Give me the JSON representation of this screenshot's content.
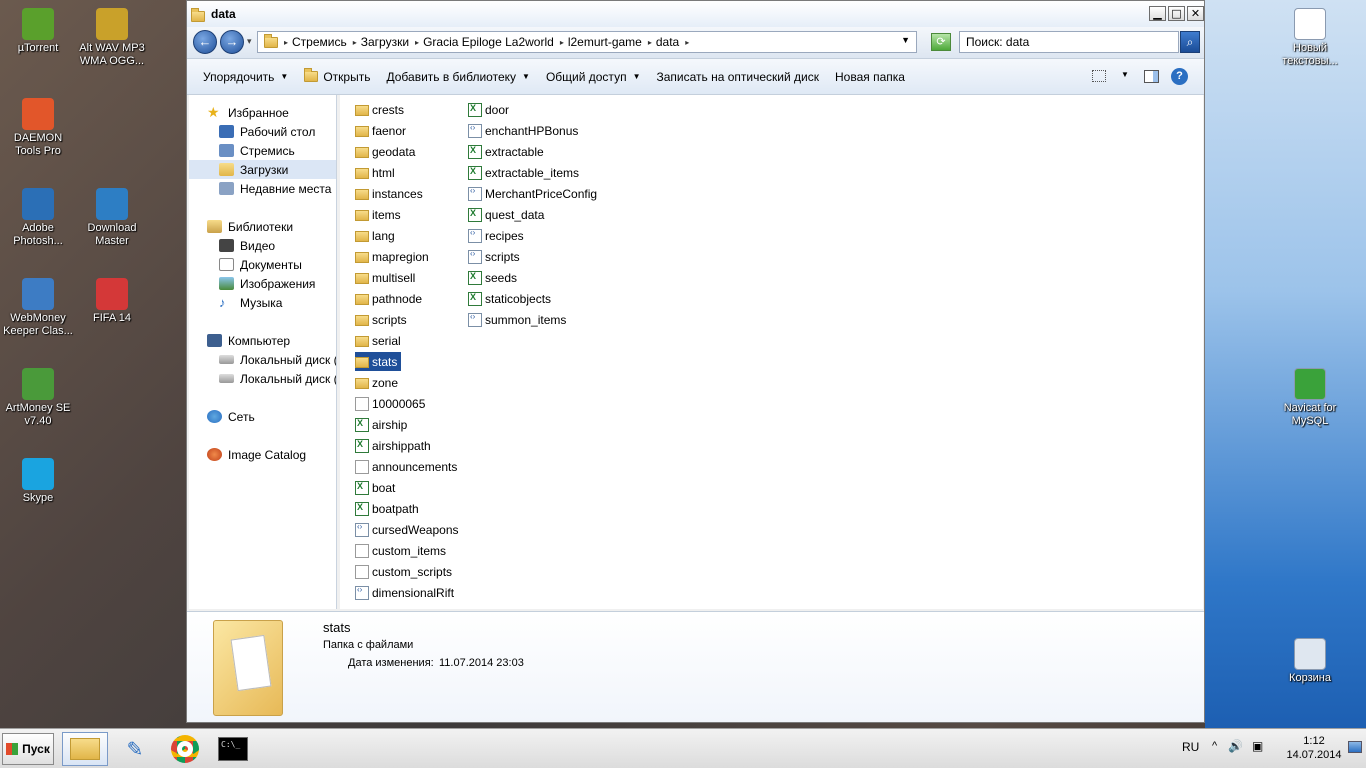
{
  "desktop": {
    "icons_left": [
      {
        "label": "µTorrent",
        "icon": "utorrent-icon",
        "color": "#5aa02c"
      },
      {
        "label": "Alt WAV MP3 WMA OGG...",
        "icon": "disc-icon",
        "color": "#c9a12a"
      },
      {
        "label": "DAEMON Tools Pro",
        "icon": "daemon-tools-icon",
        "color": "#e2562a"
      },
      {
        "label": "Adobe Photosh...",
        "icon": "photoshop-icon",
        "color": "#2b6fb6"
      },
      {
        "label": "Download Master",
        "icon": "download-master-icon",
        "color": "#2d7ec4"
      },
      {
        "label": "WebMoney Keeper Clas...",
        "icon": "webmoney-icon",
        "color": "#3d7cc4"
      },
      {
        "label": "FIFA 14",
        "icon": "fifa-icon",
        "color": "#d43838"
      },
      {
        "label": "ArtMoney SE v7.40",
        "icon": "artmoney-icon",
        "color": "#4a9a3a"
      },
      {
        "label": "Skype",
        "icon": "skype-icon",
        "color": "#1aa4e0"
      }
    ],
    "icons_right": [
      {
        "label": "Новый текстовы...",
        "icon": "text-document-icon",
        "color": "#ffffff"
      },
      {
        "label": "Navicat for MySQL",
        "icon": "navicat-icon",
        "color": "#3aa23a"
      },
      {
        "label": "Корзина",
        "icon": "recycle-bin-icon",
        "color": "#dfe7f0"
      }
    ]
  },
  "window": {
    "title": "data",
    "controls": {
      "minimize": "▁",
      "maximize": "□",
      "close": "✕"
    },
    "nav": {
      "back": "←",
      "forward": "→",
      "recent": "▾"
    },
    "breadcrumb": [
      "Стремись",
      "Загрузки",
      "Gracia Epiloge La2world",
      "l2emurt-game",
      "data"
    ],
    "breadcrumb_separator": "▸",
    "search_placeholder": "Поиск: data",
    "search_icon_glyph": "⌕",
    "refresh_glyph": "⟳",
    "toolbar": {
      "organize": "Упорядочить",
      "open": "Открыть",
      "add_to_library": "Добавить в библиотеку",
      "share": "Общий доступ",
      "burn": "Записать на оптический диск",
      "new_folder": "Новая папка",
      "help": "?"
    }
  },
  "navpane": {
    "favorites": {
      "label": "Избранное",
      "items": [
        "Рабочий стол",
        "Стремись",
        "Загрузки",
        "Недавние места"
      ]
    },
    "libraries": {
      "label": "Библиотеки",
      "items": [
        "Видео",
        "Документы",
        "Изображения",
        "Музыка"
      ]
    },
    "computer": {
      "label": "Компьютер",
      "items": [
        "Локальный диск (C",
        "Локальный диск (E"
      ]
    },
    "network": {
      "label": "Сеть"
    },
    "image_catalog": {
      "label": "Image Catalog"
    },
    "selected": "Загрузки"
  },
  "files": {
    "column1": [
      {
        "name": "crests",
        "type": "folder"
      },
      {
        "name": "faenor",
        "type": "folder"
      },
      {
        "name": "geodata",
        "type": "folder"
      },
      {
        "name": "html",
        "type": "folder"
      },
      {
        "name": "instances",
        "type": "folder"
      },
      {
        "name": "items",
        "type": "folder"
      },
      {
        "name": "lang",
        "type": "folder"
      },
      {
        "name": "mapregion",
        "type": "folder"
      },
      {
        "name": "multisell",
        "type": "folder"
      },
      {
        "name": "pathnode",
        "type": "folder"
      },
      {
        "name": "scripts",
        "type": "folder"
      },
      {
        "name": "serial",
        "type": "folder"
      },
      {
        "name": "stats",
        "type": "folder",
        "selected": true
      },
      {
        "name": "zone",
        "type": "folder"
      },
      {
        "name": "10000065",
        "type": "doc"
      },
      {
        "name": "airship",
        "type": "xls"
      },
      {
        "name": "airshippath",
        "type": "xls"
      },
      {
        "name": "announcements",
        "type": "doc"
      },
      {
        "name": "boat",
        "type": "xls"
      },
      {
        "name": "boatpath",
        "type": "xls"
      },
      {
        "name": "cursedWeapons",
        "type": "xml"
      },
      {
        "name": "custom_items",
        "type": "doc"
      },
      {
        "name": "custom_scripts",
        "type": "doc"
      },
      {
        "name": "dimensionalRift",
        "type": "xml"
      }
    ],
    "column2": [
      {
        "name": "door",
        "type": "xls"
      },
      {
        "name": "enchantHPBonus",
        "type": "xml"
      },
      {
        "name": "extractable",
        "type": "xls"
      },
      {
        "name": "extractable_items",
        "type": "xls"
      },
      {
        "name": "MerchantPriceConfig",
        "type": "xml"
      },
      {
        "name": "quest_data",
        "type": "xls"
      },
      {
        "name": "recipes",
        "type": "xml"
      },
      {
        "name": "scripts",
        "type": "xml"
      },
      {
        "name": "seeds",
        "type": "xls"
      },
      {
        "name": "staticobjects",
        "type": "xls"
      },
      {
        "name": "summon_items",
        "type": "xml"
      }
    ]
  },
  "details": {
    "name": "stats",
    "type": "Папка с файлами",
    "modified_label": "Дата изменения:",
    "modified_value": "11.07.2014 23:03"
  },
  "taskbar": {
    "start": "Пуск",
    "apps": [
      {
        "name": "explorer",
        "icon": "explorer-icon",
        "active": true
      },
      {
        "name": "feather",
        "icon": "feather-icon",
        "active": false
      },
      {
        "name": "chrome",
        "icon": "chrome-icon",
        "active": false
      },
      {
        "name": "cmd",
        "icon": "cmd-icon",
        "active": false
      }
    ],
    "language": "RU",
    "tray_glyphs": {
      "show_hidden": "^",
      "volume": "🔊",
      "network": "▣"
    },
    "time": "1:12",
    "date": "14.07.2014"
  },
  "colors": {
    "selection": "#1f4f99",
    "nav_selection": "#dbe6f5"
  }
}
